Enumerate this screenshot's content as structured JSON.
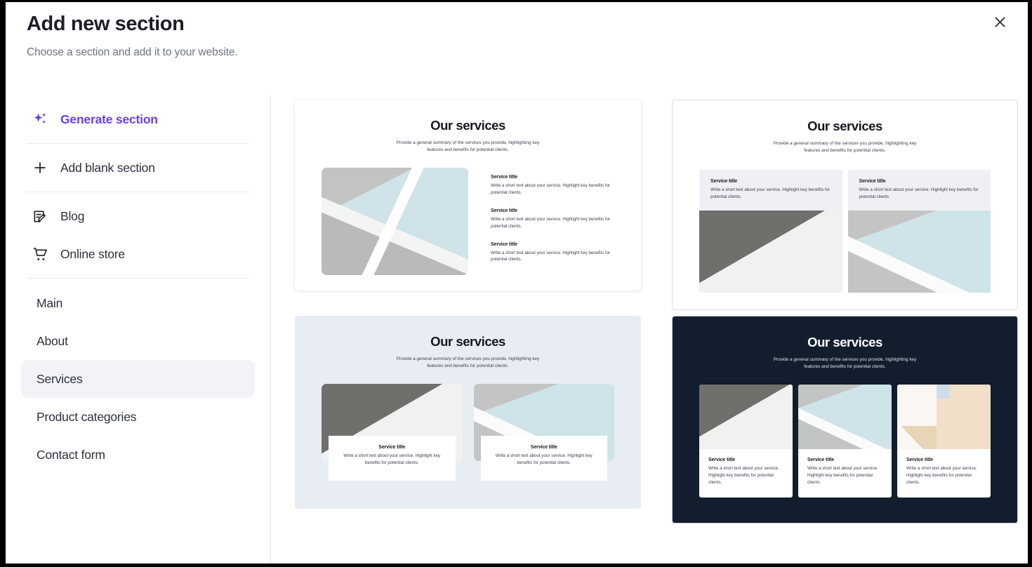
{
  "header": {
    "title": "Add new section",
    "subtitle": "Choose a section and add it to your website.",
    "close_icon": "close-icon"
  },
  "colors": {
    "accent_purple": "#6b3fe8",
    "text_dark": "#1c1f29",
    "text_muted": "#6b7280",
    "selected_bg": "#f1f3f7",
    "dark_section_bg": "#121d2d",
    "light_section_bg": "#e8edf4"
  },
  "sidebar": {
    "actions": [
      {
        "label": "Generate section",
        "icon": "sparkles-icon"
      },
      {
        "label": "Add blank section",
        "icon": "plus-icon"
      }
    ],
    "content_types": [
      {
        "label": "Blog",
        "icon": "blog-document-pencil-icon"
      },
      {
        "label": "Online store",
        "icon": "shopping-cart-icon"
      }
    ],
    "pages": [
      {
        "label": "Main",
        "selected": false
      },
      {
        "label": "About",
        "selected": false
      },
      {
        "label": "Services",
        "selected": true
      },
      {
        "label": "Product categories",
        "selected": false
      },
      {
        "label": "Contact form",
        "selected": false
      }
    ]
  },
  "gallery": {
    "heading": "Our services",
    "subheading": "Provide a general summary of the services you provide, highlighting key features and benefits for potential clients.",
    "service_title": "Service title",
    "service_body": "Write a short text about your service. Highlight key benefits for potential clients.",
    "templates": [
      {
        "name": "image-left-three-services",
        "layout": "image-left-list-right",
        "background": "#ffffff",
        "items": 3
      },
      {
        "name": "two-cards-text-above-image",
        "layout": "two-column-text-top",
        "background": "#ffffff",
        "items": 2
      },
      {
        "name": "two-cards-overlay-text",
        "layout": "two-column-overlay-card",
        "background": "#e8edf4",
        "items": 2
      },
      {
        "name": "dark-three-cards",
        "layout": "three-column-dark",
        "background": "#121d2d",
        "items": 3
      }
    ]
  }
}
